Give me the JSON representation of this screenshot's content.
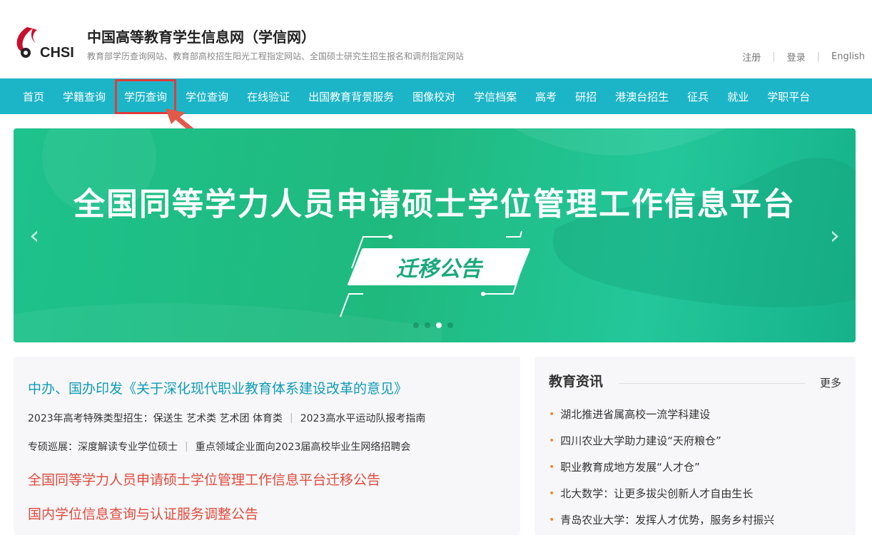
{
  "header": {
    "logo_text": "CHSI",
    "title": "中国高等教育学生信息网（学信网）",
    "subtitle": "教育部学历查询网站、教育部高校招生阳光工程指定网站、全国硕士研究生招生报名和调剂指定网站",
    "links": {
      "register": "注册",
      "login": "登录",
      "english": "English"
    }
  },
  "nav": {
    "items": [
      "首页",
      "学籍查询",
      "学历查询",
      "学位查询",
      "在线验证",
      "出国教育背景服务",
      "图像校对",
      "学信档案",
      "高考",
      "研招",
      "港澳台招生",
      "征兵",
      "就业",
      "学职平台"
    ],
    "highlighted_index": 2,
    "bg_color": "#1cb5c8"
  },
  "banner": {
    "title": "全国同等学力人员申请硕士学位管理工作信息平台",
    "tag": "迁移公告",
    "prev": "‹",
    "next": "›",
    "slide_count": 4,
    "active_slide": 3
  },
  "news_left": {
    "headline": "中办、国办印发《关于深化现代职业教育体系建设改革的意见》",
    "line1": {
      "a": "2023年高考特殊类型招生：保送生  艺术类  艺术团  体育类",
      "b": "2023高水平运动队报考指南"
    },
    "line2": {
      "a": "专硕巡展：深度解读专业学位硕士",
      "b": "重点领域企业面向2023届高校毕业生网络招聘会"
    },
    "notice1": "全国同等学力人员申请硕士学位管理工作信息平台迁移公告",
    "notice2": "国内学位信息查询与认证服务调整公告"
  },
  "news_right": {
    "title": "教育资讯",
    "more": "更多",
    "items": [
      "湖北推进省属高校一流学科建设",
      "四川农业大学助力建设“天府粮仓”",
      "职业教育成地方发展“人才仓”",
      "北大数学：让更多拔尖创新人才自由生长",
      "青岛农业大学：发挥人才优势，服务乡村振兴"
    ]
  },
  "colors": {
    "accent": "#1cb5c8",
    "highlight_red": "#e03c3c",
    "news_teal": "#0f9bb5",
    "news_red": "#e04a3c",
    "banner_green": "#1fb97e"
  }
}
